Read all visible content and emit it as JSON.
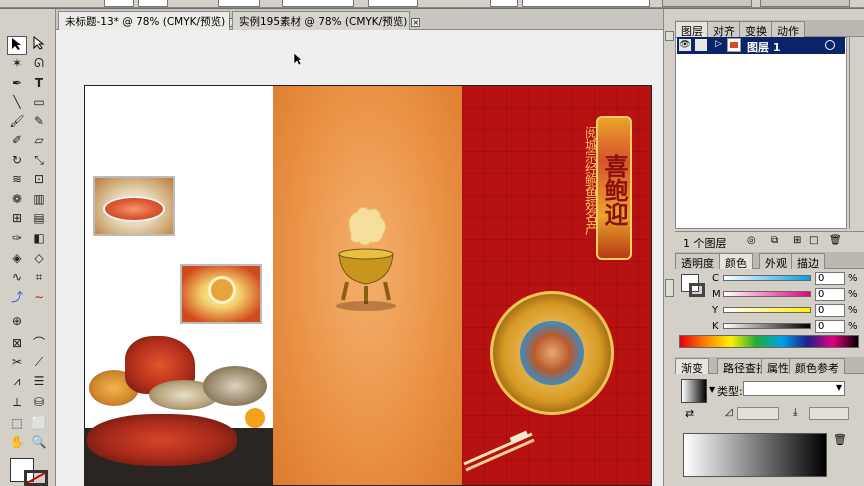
{
  "tabs": [
    {
      "label": "未标题-13* @ 78% (CMYK/预览)",
      "active": true
    },
    {
      "label": "实例195素材 @ 78% (CMYK/预览)",
      "active": false
    }
  ],
  "tab_close_glyph": "×",
  "artboard": {
    "vertical_text_1": "阅城宗经鲍鱼翅名产",
    "seal_text": "喜鲍迎",
    "colors": {
      "left": "#ffffff",
      "middle": "#ea9347",
      "right": "#b71112",
      "gold": "#e8b43a"
    }
  },
  "layers_panel": {
    "tabs": [
      "图层",
      "对齐",
      "变换",
      "动作"
    ],
    "layer_name": "图层 1",
    "footer_count": "1 个图层"
  },
  "color_panel": {
    "tabs": [
      "透明度",
      "颜色",
      "外观",
      "描边"
    ],
    "channels": [
      {
        "label": "C",
        "value": "0",
        "unit": "%"
      },
      {
        "label": "M",
        "value": "0",
        "unit": "%"
      },
      {
        "label": "Y",
        "value": "0",
        "unit": "%"
      },
      {
        "label": "K",
        "value": "0",
        "unit": "%"
      }
    ]
  },
  "gradient_panel": {
    "tabs": [
      "渐变",
      "路径查找",
      "属性",
      "颜色参考"
    ],
    "type_label": "类型:",
    "type_value": ""
  },
  "icons": [
    "selection-tool-icon",
    "direct-selection-icon",
    "magic-wand-icon",
    "lasso-icon",
    "pen-icon",
    "type-icon",
    "line-icon",
    "rectangle-icon",
    "paintbrush-icon",
    "pencil-icon",
    "blob-brush-icon",
    "eraser-icon",
    "rotate-icon",
    "scale-icon",
    "warp-icon",
    "free-transform-icon",
    "symbol-sprayer-icon",
    "column-graph-icon",
    "mesh-icon",
    "gradient-icon",
    "eyedropper-icon",
    "blend-icon",
    "live-paint-icon",
    "slice-icon",
    "hand-icon",
    "zoom-icon",
    "fill-swatch-icon",
    "stroke-swatch-icon",
    "eye-icon",
    "target-circle-icon",
    "trash-icon",
    "new-layer-icon"
  ]
}
